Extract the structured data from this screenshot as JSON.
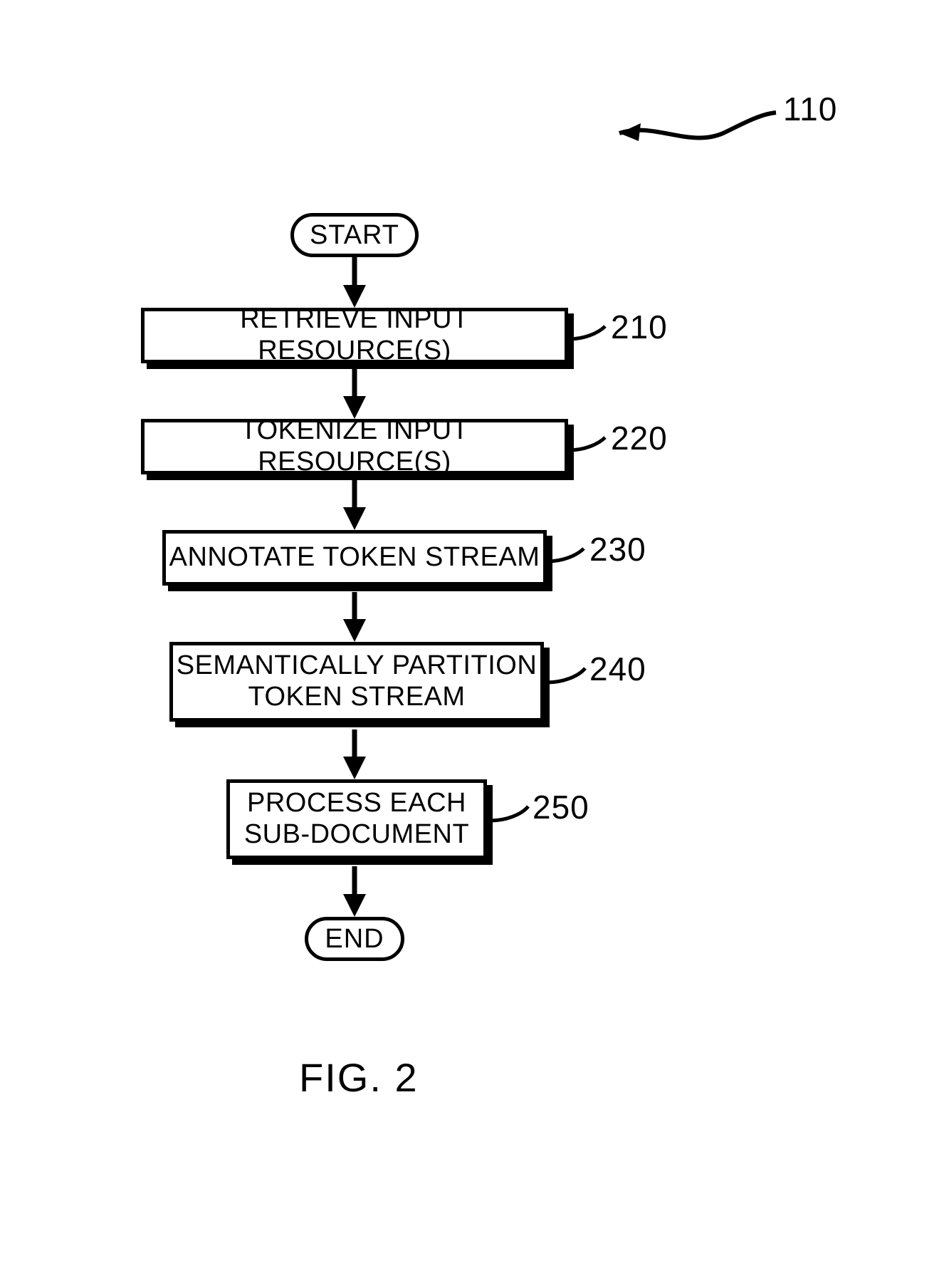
{
  "figure": {
    "caption": "FIG. 2",
    "reference_number": "110"
  },
  "flow": {
    "start": "START",
    "end": "END",
    "steps": [
      {
        "label": "RETRIEVE INPUT RESOURCE(S)",
        "ref": "210"
      },
      {
        "label": "TOKENIZE INPUT RESOURCE(S)",
        "ref": "220"
      },
      {
        "label": "ANNOTATE TOKEN STREAM",
        "ref": "230"
      },
      {
        "label": "SEMANTICALLY PARTITION\nTOKEN STREAM",
        "ref": "240"
      },
      {
        "label": "PROCESS EACH\nSUB-DOCUMENT",
        "ref": "250"
      }
    ]
  }
}
